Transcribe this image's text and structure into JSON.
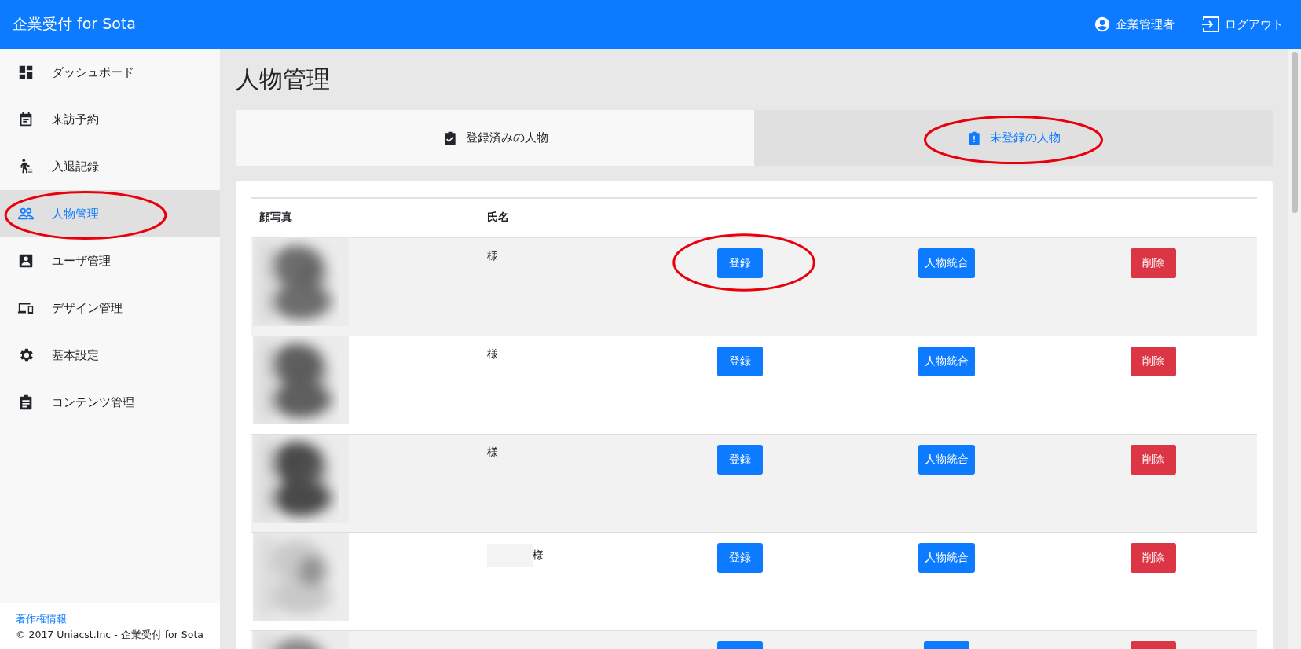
{
  "header": {
    "title": "企業受付 for Sota",
    "user": "企業管理者",
    "logout": "ログアウト"
  },
  "sidebar": {
    "items": [
      {
        "label": "ダッシュボード",
        "selected": false
      },
      {
        "label": "来訪予約",
        "selected": false
      },
      {
        "label": "入退記録",
        "selected": false
      },
      {
        "label": "人物管理",
        "selected": true,
        "circled": true
      },
      {
        "label": "ユーザ管理",
        "selected": false
      },
      {
        "label": "デザイン管理",
        "selected": false
      },
      {
        "label": "基本設定",
        "selected": false
      },
      {
        "label": "コンテンツ管理",
        "selected": false
      }
    ],
    "footer_link": "著作権情報",
    "copyright": "© 2017 Uniacst.Inc - 企業受付 for Sota"
  },
  "page_title": "人物管理",
  "tabs": [
    {
      "label": "登録済みの人物",
      "selected": false
    },
    {
      "label": "未登録の人物",
      "selected": true,
      "circled": true
    }
  ],
  "table": {
    "columns": [
      "顔写真",
      "氏名"
    ],
    "rows": [
      {
        "name": "様",
        "actions": [
          {
            "kind": "primary",
            "label": "登録",
            "circled": true
          },
          {
            "kind": "primary",
            "label": "人物統合"
          },
          {
            "kind": "danger",
            "label": "削除"
          }
        ]
      },
      {
        "name": "様",
        "actions": [
          {
            "kind": "primary",
            "label": "登録"
          },
          {
            "kind": "primary",
            "label": "人物統合"
          },
          {
            "kind": "danger",
            "label": "削除"
          }
        ]
      },
      {
        "name": "様",
        "actions": [
          {
            "kind": "primary",
            "label": "登録"
          },
          {
            "kind": "primary",
            "label": "人物統合"
          },
          {
            "kind": "danger",
            "label": "削除"
          }
        ]
      },
      {
        "name": "様",
        "redacted": true,
        "actions": [
          {
            "kind": "primary",
            "label": "登録"
          },
          {
            "kind": "primary",
            "label": "人物統合"
          },
          {
            "kind": "danger",
            "label": "削除"
          }
        ]
      },
      {
        "actions": [
          {
            "kind": "primary"
          },
          {
            "kind": "primary"
          },
          {
            "kind": "danger"
          }
        ]
      }
    ]
  }
}
